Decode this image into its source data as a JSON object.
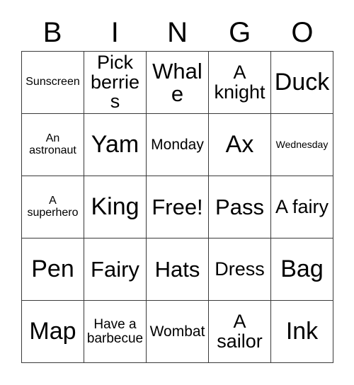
{
  "card": {
    "header": {
      "letters": [
        "B",
        "I",
        "N",
        "G",
        "O"
      ]
    },
    "grid": {
      "rows": [
        [
          {
            "text": "Sunscreen",
            "size": "fs-sm"
          },
          {
            "text": "Pick berries",
            "size": "fs-xl"
          },
          {
            "text": "Whale",
            "size": "fs-xxl"
          },
          {
            "text": "A knight",
            "size": "fs-xl"
          },
          {
            "text": "Duck",
            "size": "fs-huge"
          }
        ],
        [
          {
            "text": "An astronaut",
            "size": "fs-sm"
          },
          {
            "text": "Yam",
            "size": "fs-huge"
          },
          {
            "text": "Monday",
            "size": "fs-lg"
          },
          {
            "text": "Ax",
            "size": "fs-huge"
          },
          {
            "text": "Wednesday",
            "size": "fs-xs"
          }
        ],
        [
          {
            "text": "A superhero",
            "size": "fs-sm"
          },
          {
            "text": "King",
            "size": "fs-huge"
          },
          {
            "text": "Free!",
            "size": "fs-xxl"
          },
          {
            "text": "Pass",
            "size": "fs-xxl"
          },
          {
            "text": "A fairy",
            "size": "fs-xl"
          }
        ],
        [
          {
            "text": "Pen",
            "size": "fs-huge"
          },
          {
            "text": "Fairy",
            "size": "fs-xxl"
          },
          {
            "text": "Hats",
            "size": "fs-xxl"
          },
          {
            "text": "Dress",
            "size": "fs-xl"
          },
          {
            "text": "Bag",
            "size": "fs-huge"
          }
        ],
        [
          {
            "text": "Map",
            "size": "fs-huge"
          },
          {
            "text": "Have a barbecue",
            "size": "fs-md"
          },
          {
            "text": "Wombat",
            "size": "fs-lg"
          },
          {
            "text": "A sailor",
            "size": "fs-xl"
          },
          {
            "text": "Ink",
            "size": "fs-huge"
          }
        ]
      ]
    },
    "colors": {
      "background": "#ffffff",
      "text": "#000000",
      "border": "#3a3a3a"
    }
  }
}
